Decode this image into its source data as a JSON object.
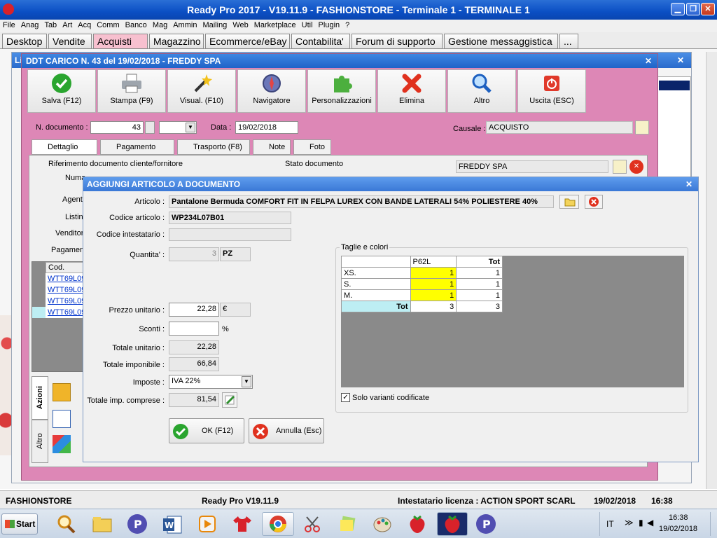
{
  "window": {
    "title": "Ready Pro 2017 - V19.11.9 - FASHIONSTORE - Terminale 1 - TERMINALE 1",
    "min": "▁",
    "max": "❐",
    "close": "✕"
  },
  "menu": [
    "File",
    "Anag",
    "Tab",
    "Art",
    "Acq",
    "Comm",
    "Banco",
    "Mag",
    "Ammin",
    "Mailing",
    "Web",
    "Marketplace",
    "Util",
    "Plugin",
    "?"
  ],
  "tabs": [
    {
      "label": "Desktop"
    },
    {
      "label": "Vendite"
    },
    {
      "label": "Acquisti",
      "close": "✕"
    },
    {
      "label": "Magazzino"
    },
    {
      "label": "Ecommerce/eBay"
    },
    {
      "label": "Contabilita'"
    },
    {
      "label": "Forum di supporto"
    },
    {
      "label": "Gestione messaggistica"
    },
    {
      "label": "..."
    }
  ],
  "bg": {
    "list_title_fragment": "Li",
    "close": "✕"
  },
  "ddt": {
    "title": "DDT CARICO N. 43 del 19/02/2018 - FREDDY SPA",
    "close": "✕",
    "toolbar": [
      "Salva (F12)",
      "Stampa (F9)",
      "Visual. (F10)",
      "Navigatore",
      "Personalizzazioni",
      "Elimina",
      "Altro",
      "Uscita (ESC)"
    ],
    "numero_label": "N. documento :",
    "numero": "43",
    "data_label": "Data :",
    "data": "19/02/2018",
    "causale_label": "Causale :",
    "causale": "ACQUISTO",
    "subtabs": [
      "Dettaglio (F5)",
      "Pagamento (F6)",
      "Trasporto (F8)",
      "Note",
      "Foto"
    ],
    "rif_label": "Riferimento documento cliente/fornitore",
    "stato_label": "Stato documento",
    "fornitore": "FREDDY SPA",
    "side_labels": [
      "Numa",
      "Agent",
      "Listin",
      "Venditor",
      "Pagamen"
    ],
    "grid_header": "Cod.",
    "grid_rows": [
      "WTT69L09",
      "WTT69L09",
      "WTT69L09",
      "WTT69L09"
    ],
    "side_tabs": [
      "Azioni",
      "Altro"
    ]
  },
  "dialog": {
    "title": "AGGIUNGI ARTICOLO A DOCUMENTO",
    "close": "✕",
    "articolo_label": "Articolo :",
    "articolo": "Pantalone Bermuda COMFORT FIT IN FELPA LUREX CON BANDE LATERALI  54% POLIESTERE 40%",
    "codice_label": "Codice articolo :",
    "codice": "WP234L07B01",
    "codint_label": "Codice intestatario :",
    "codint": "",
    "quantita_label": "Quantita' :",
    "quantita": "3",
    "um": "PZ",
    "prezzo_label": "Prezzo unitario :",
    "prezzo": "22,28",
    "valuta": "€",
    "sconti_label": "Sconti :",
    "sconti": "",
    "perc": "%",
    "totunit_label": "Totale unitario :",
    "totunit": "22,28",
    "totimp_label": "Totale imponibile :",
    "totimp": "66,84",
    "imposte_label": "Imposte :",
    "imposte": "IVA 22%",
    "totcomp_label": "Totale imp. comprese :",
    "totcomp": "81,54",
    "taglie_label": "Taglie e colori",
    "grid": {
      "columns": [
        "",
        "P62L",
        "Tot"
      ],
      "rows": [
        {
          "size": "XS.",
          "qty": "1",
          "tot": "1"
        },
        {
          "size": "S.",
          "qty": "1",
          "tot": "1"
        },
        {
          "size": "M.",
          "qty": "1",
          "tot": "1"
        }
      ],
      "total": {
        "label": "Tot",
        "qty": "3",
        "tot": "3"
      }
    },
    "solo_varianti_label": "Solo varianti codificate",
    "solo_varianti": true,
    "ok_label": "OK (F12)",
    "annulla_label": "Annulla (Esc)"
  },
  "statusbar": {
    "company": "FASHIONSTORE",
    "version": "Ready Pro V19.11.9",
    "license": "Intestatario licenza : ACTION SPORT SCARL",
    "date": "19/02/2018",
    "time": "16:38"
  },
  "taskbar": {
    "start": "Start",
    "lang": "IT",
    "clock_time": "16:38",
    "clock_date": "19/02/2018"
  }
}
